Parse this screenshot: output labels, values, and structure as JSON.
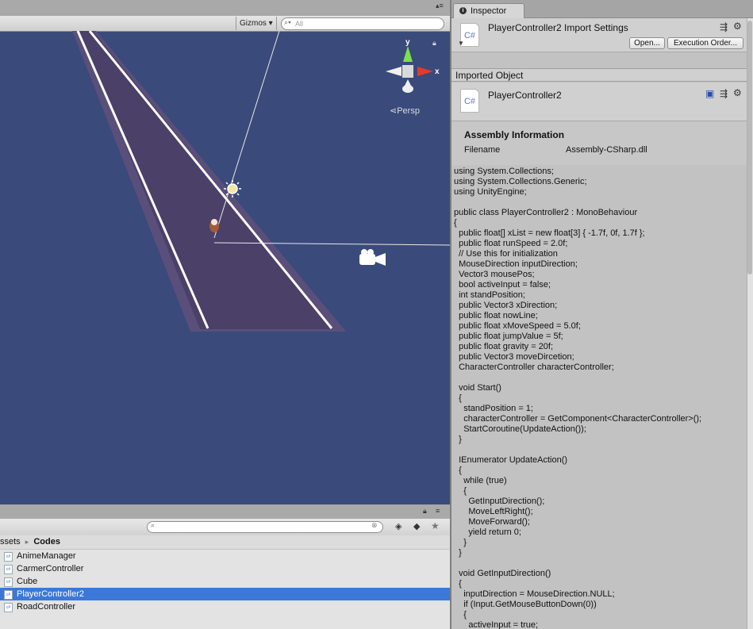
{
  "scene": {
    "toolbar": {
      "gizmos_label": "Gizmos ▾",
      "search_placeholder": "All"
    },
    "persp_label": "Persp",
    "gizmo_axes": {
      "y": "y",
      "x": "x"
    }
  },
  "project": {
    "breadcrumb": {
      "root": "ssets",
      "separator": "▸",
      "current": "Codes"
    },
    "files": [
      {
        "name": "AnimeManager",
        "selected": false
      },
      {
        "name": "CarmerController",
        "selected": false
      },
      {
        "name": "Cube",
        "selected": false
      },
      {
        "name": "PlayerController2",
        "selected": true
      },
      {
        "name": "RoadController",
        "selected": false
      }
    ]
  },
  "inspector": {
    "tab_label": "Inspector",
    "header": {
      "icon_text": "C#",
      "title": "PlayerController2 Import Settings",
      "open_button": "Open...",
      "execution_order_button": "Execution Order..."
    },
    "imported_object_label": "Imported Object",
    "imported_title": "PlayerController2",
    "assembly": {
      "title": "Assembly Information",
      "key": "Filename",
      "value": "Assembly-CSharp.dll"
    },
    "code_lines": [
      "using System.Collections;",
      "using System.Collections.Generic;",
      "using UnityEngine;",
      "",
      "public class PlayerController2 : MonoBehaviour",
      "{",
      "  public float[] xList = new float[3] { -1.7f, 0f, 1.7f };",
      "  public float runSpeed = 2.0f;",
      "  // Use this for initialization",
      "  MouseDirection inputDirection;",
      "  Vector3 mousePos;",
      "  bool activeInput = false;",
      "  int standPosition;",
      "  public Vector3 xDirection;",
      "  public float nowLine;",
      "  public float xMoveSpeed = 5.0f;",
      "  public float jumpValue = 5f;",
      "  public float gravity = 20f;",
      "  public Vector3 moveDircetion;",
      "  CharacterController characterController;",
      "",
      "  void Start()",
      "  {",
      "    standPosition = 1;",
      "    characterController = GetComponent<CharacterController>();",
      "    StartCoroutine(UpdateAction());",
      "  }",
      "",
      "  IEnumerator UpdateAction()",
      "  {",
      "    while (true)",
      "    {",
      "      GetInputDirection();",
      "      MoveLeftRight();",
      "      MoveForward();",
      "      yield return 0;",
      "    }",
      "  }",
      "",
      "  void GetInputDirection()",
      "  {",
      "    inputDirection = MouseDirection.NULL;",
      "    if (Input.GetMouseButtonDown(0))",
      "    {",
      "      activeInput = true;"
    ]
  }
}
